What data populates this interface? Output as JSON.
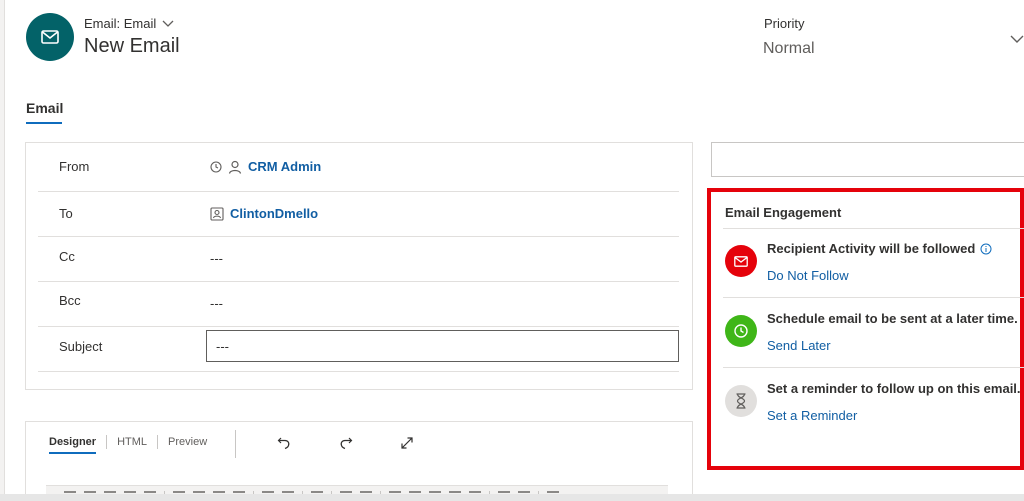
{
  "header": {
    "entity_type": "Email: Email",
    "title": "New Email",
    "priority_label": "Priority",
    "priority_value": "Normal"
  },
  "tabs": [
    {
      "label": "Email",
      "active": true
    }
  ],
  "form": {
    "rows": [
      {
        "label": "From",
        "value": "CRM Admin"
      },
      {
        "label": "To",
        "value": "ClintonDmello"
      },
      {
        "label": "Cc",
        "value": "---"
      },
      {
        "label": "Bcc",
        "value": "---"
      },
      {
        "label": "Subject",
        "value": "---"
      }
    ]
  },
  "engagement": {
    "title": "Email Engagement",
    "items": [
      {
        "text": "Recipient Activity will be followed",
        "link": "Do Not Follow",
        "color": "#e5020b",
        "icon": "envelope-icon"
      },
      {
        "text": "Schedule email to be sent at a later time.",
        "link": "Send Later",
        "color": "#3fb618",
        "icon": "clock-icon"
      },
      {
        "text": "Set a reminder to follow up on this email.",
        "link": "Set a Reminder",
        "color": "#e1dfdd",
        "icon": "hourglass-icon"
      }
    ]
  },
  "editor": {
    "tabs": [
      "Designer",
      "HTML",
      "Preview"
    ]
  },
  "colors": {
    "brand": "#036268",
    "highlight_border": "#e5020b",
    "link": "#115ea3"
  }
}
